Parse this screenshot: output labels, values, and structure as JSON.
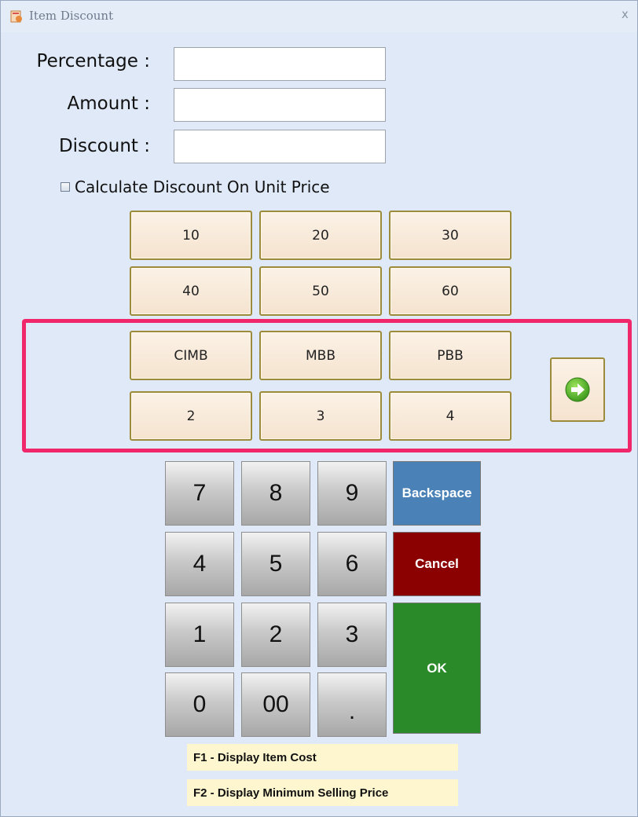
{
  "window": {
    "title": "Item Discount",
    "close_glyph": "x"
  },
  "form": {
    "percentage_label": "Percentage :",
    "amount_label": "Amount :",
    "discount_label": "Discount :",
    "percentage_value": "",
    "amount_value": "",
    "discount_value": "",
    "checkbox_label": "Calculate Discount On Unit Price",
    "checkbox_checked": false
  },
  "quick_buttons": [
    "10",
    "20",
    "30",
    "40",
    "50",
    "60"
  ],
  "preset_buttons": [
    "CIMB",
    "MBB",
    "PBB",
    "2",
    "3",
    "4"
  ],
  "keypad": {
    "keys": [
      "7",
      "8",
      "9",
      "4",
      "5",
      "6",
      "1",
      "2",
      "3",
      "0",
      "00",
      "."
    ],
    "backspace": "Backspace",
    "cancel": "Cancel",
    "ok": "OK"
  },
  "hints": [
    "F1 - Display Item Cost",
    "F2 - Display Minimum Selling Price"
  ],
  "colors": {
    "backspace": "#4a82b8",
    "cancel": "#8b0000",
    "ok": "#2a8a2a",
    "highlight": "#f0276b",
    "window_bg": "#dfe9f8"
  },
  "icons": {
    "title": "app-icon",
    "next": "arrow-right-circle-icon"
  }
}
